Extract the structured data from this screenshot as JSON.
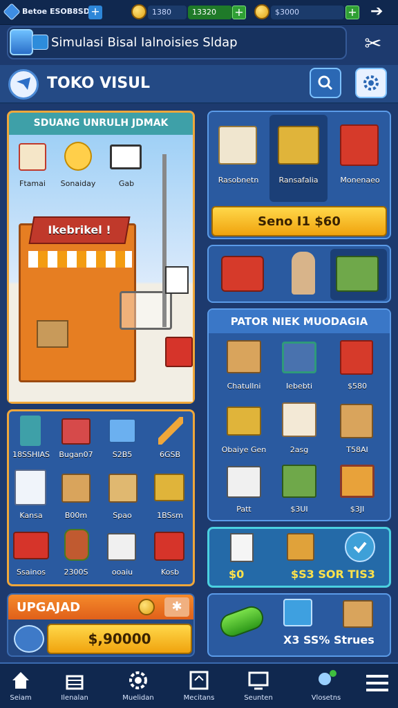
{
  "topbar": {
    "left_text": "Betoe ESOB8SD",
    "pill1": "1380",
    "pill2": "13320",
    "pill3": "$3000"
  },
  "header": {
    "title": "Simulasi Bisal Ialnoisies Sldap",
    "shop_title": "TOKO VISUL"
  },
  "left_panel": {
    "title": "SDUANG UNRULH JDMAK",
    "mini_items": [
      "Ftamai",
      "Sonaiday",
      "Gab"
    ],
    "scene_labels": [
      "Ikebrikel !"
    ]
  },
  "right_panel": {
    "tabs": [
      "Rasobnetn",
      "Ransafalia",
      "Monenaeo"
    ],
    "send_button": "Seno I1 $60"
  },
  "market": {
    "title": "PATOR NIEK MUODAGIA",
    "items": [
      "Chatullni",
      "Iebebti",
      "$580",
      "Obaiye Gen",
      "2asg",
      "T58AI",
      "Patt",
      "$3UI",
      "$3JI"
    ]
  },
  "inventory": {
    "items": [
      "18SSHIAS",
      "Bugan07",
      "S2B5",
      "6GSB",
      "Kansa",
      "B00m",
      "Spao",
      "1BSsm",
      "Ssainos",
      "2300S",
      "ooaiu",
      "Kosb"
    ]
  },
  "summary": {
    "left": "$0",
    "right": "$S3 SOR TIS3"
  },
  "upgrade": {
    "title": "UPGAJAD",
    "value": "$,90000"
  },
  "promo": {
    "text": "X3 SS% Strues"
  },
  "bottom_nav": [
    "Seiam",
    "Ilenalan",
    "Muelidan",
    "Mecitans",
    "Seunten",
    "Vlosetns"
  ]
}
